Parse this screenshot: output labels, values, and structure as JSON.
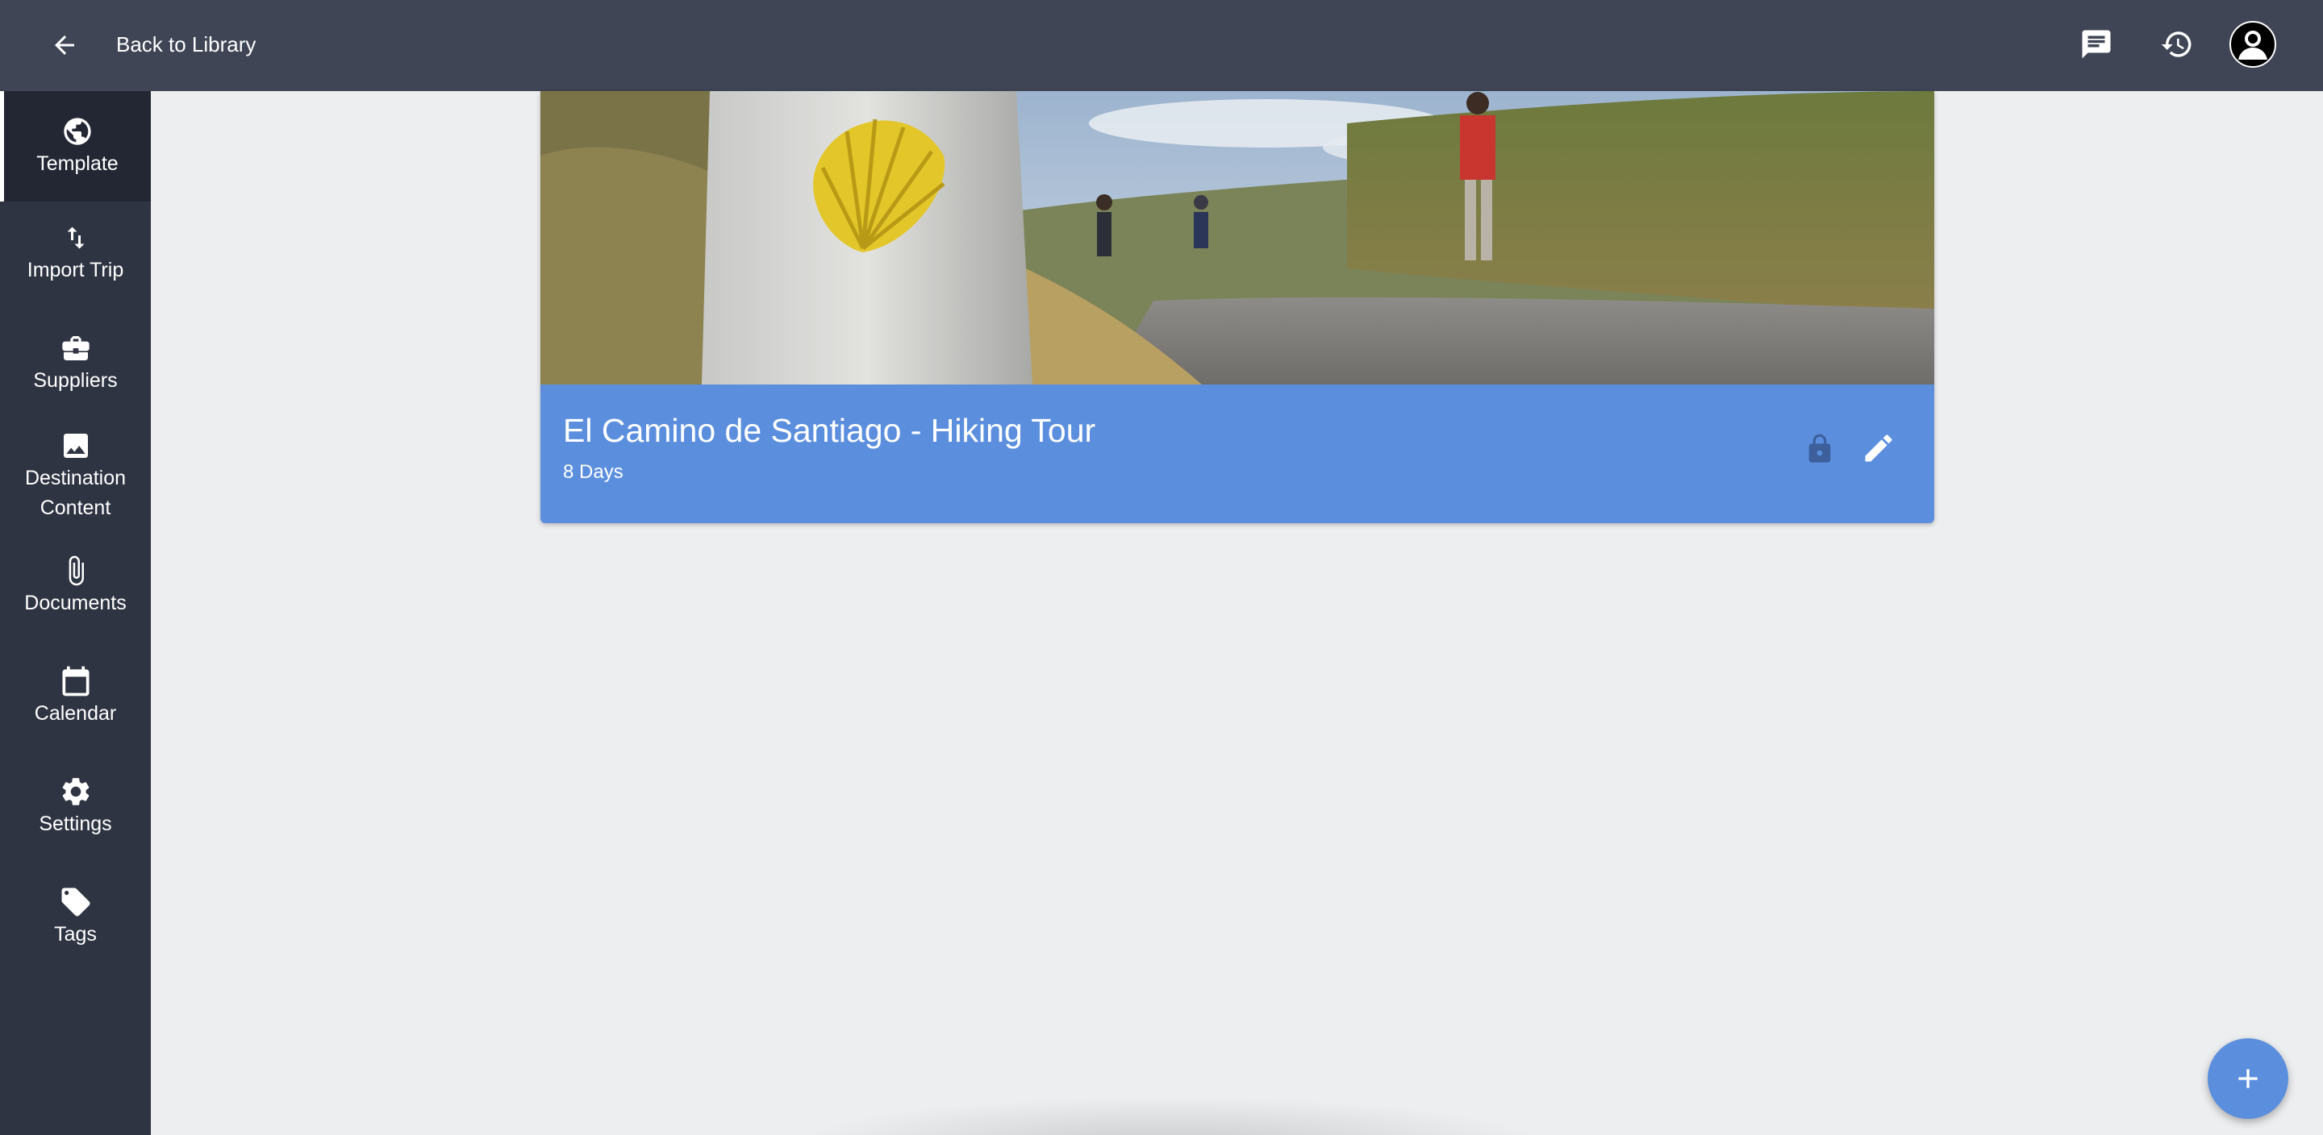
{
  "header": {
    "back_label": "Back to Library",
    "icons": [
      "arrow-left-icon",
      "chat-icon",
      "history-icon",
      "avatar-icon"
    ]
  },
  "sidebar": {
    "items": [
      {
        "label": "Template",
        "icon": "globe-icon",
        "active": true
      },
      {
        "label": "Import Trip",
        "icon": "import-arrows-icon",
        "active": false
      },
      {
        "label": "Suppliers",
        "icon": "briefcase-icon",
        "active": false
      },
      {
        "label": "Destination Content",
        "icon": "image-icon",
        "active": false
      },
      {
        "label": "Documents",
        "icon": "paperclip-icon",
        "active": false
      },
      {
        "label": "Calendar",
        "icon": "calendar-icon",
        "active": false
      },
      {
        "label": "Settings",
        "icon": "gear-icon",
        "active": false
      },
      {
        "label": "Tags",
        "icon": "tag-icon",
        "active": false
      }
    ]
  },
  "trip_card": {
    "title": "El Camino de Santiago - Hiking Tour",
    "duration": "8 Days",
    "icons": [
      "lock-icon",
      "pencil-icon"
    ]
  },
  "fab": {
    "icon": "plus-icon"
  },
  "colors": {
    "topbar": "#3f4555",
    "sidebar": "#2f3442",
    "sidebar_active": "#232734",
    "card_accent": "#5b8fde",
    "page_bg": "#edeef0"
  }
}
